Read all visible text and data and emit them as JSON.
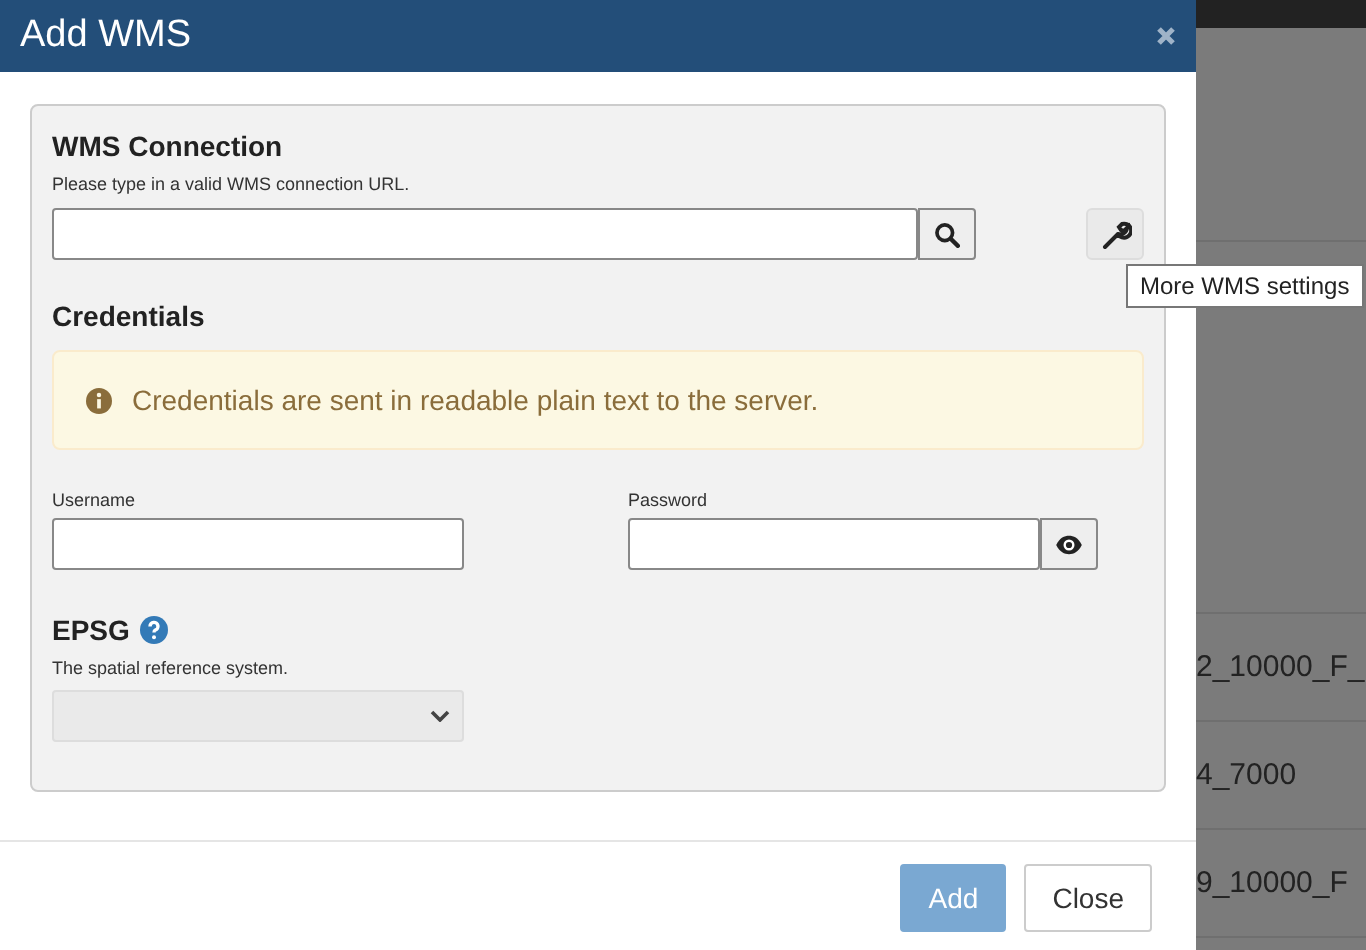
{
  "dialog": {
    "title": "Add WMS"
  },
  "connection": {
    "heading": "WMS Connection",
    "hint": "Please type in a valid WMS connection URL.",
    "settings_tooltip": "More WMS settings"
  },
  "credentials": {
    "heading": "Credentials",
    "alert": "Credentials are sent in readable plain text to the server.",
    "username_label": "Username",
    "password_label": "Password"
  },
  "epsg": {
    "heading": "EPSG",
    "hint": "The spatial reference system.",
    "disabled": true
  },
  "footer": {
    "buttons": [
      {
        "label": "Add",
        "kind": "primary",
        "disabled": true
      },
      {
        "label": "Close",
        "kind": "default",
        "disabled": false
      }
    ]
  },
  "background_table": {
    "rows": [
      {
        "cell": "2_10000_F_"
      },
      {
        "cell": "4_7000"
      },
      {
        "cell": "9_10000_F"
      }
    ]
  }
}
